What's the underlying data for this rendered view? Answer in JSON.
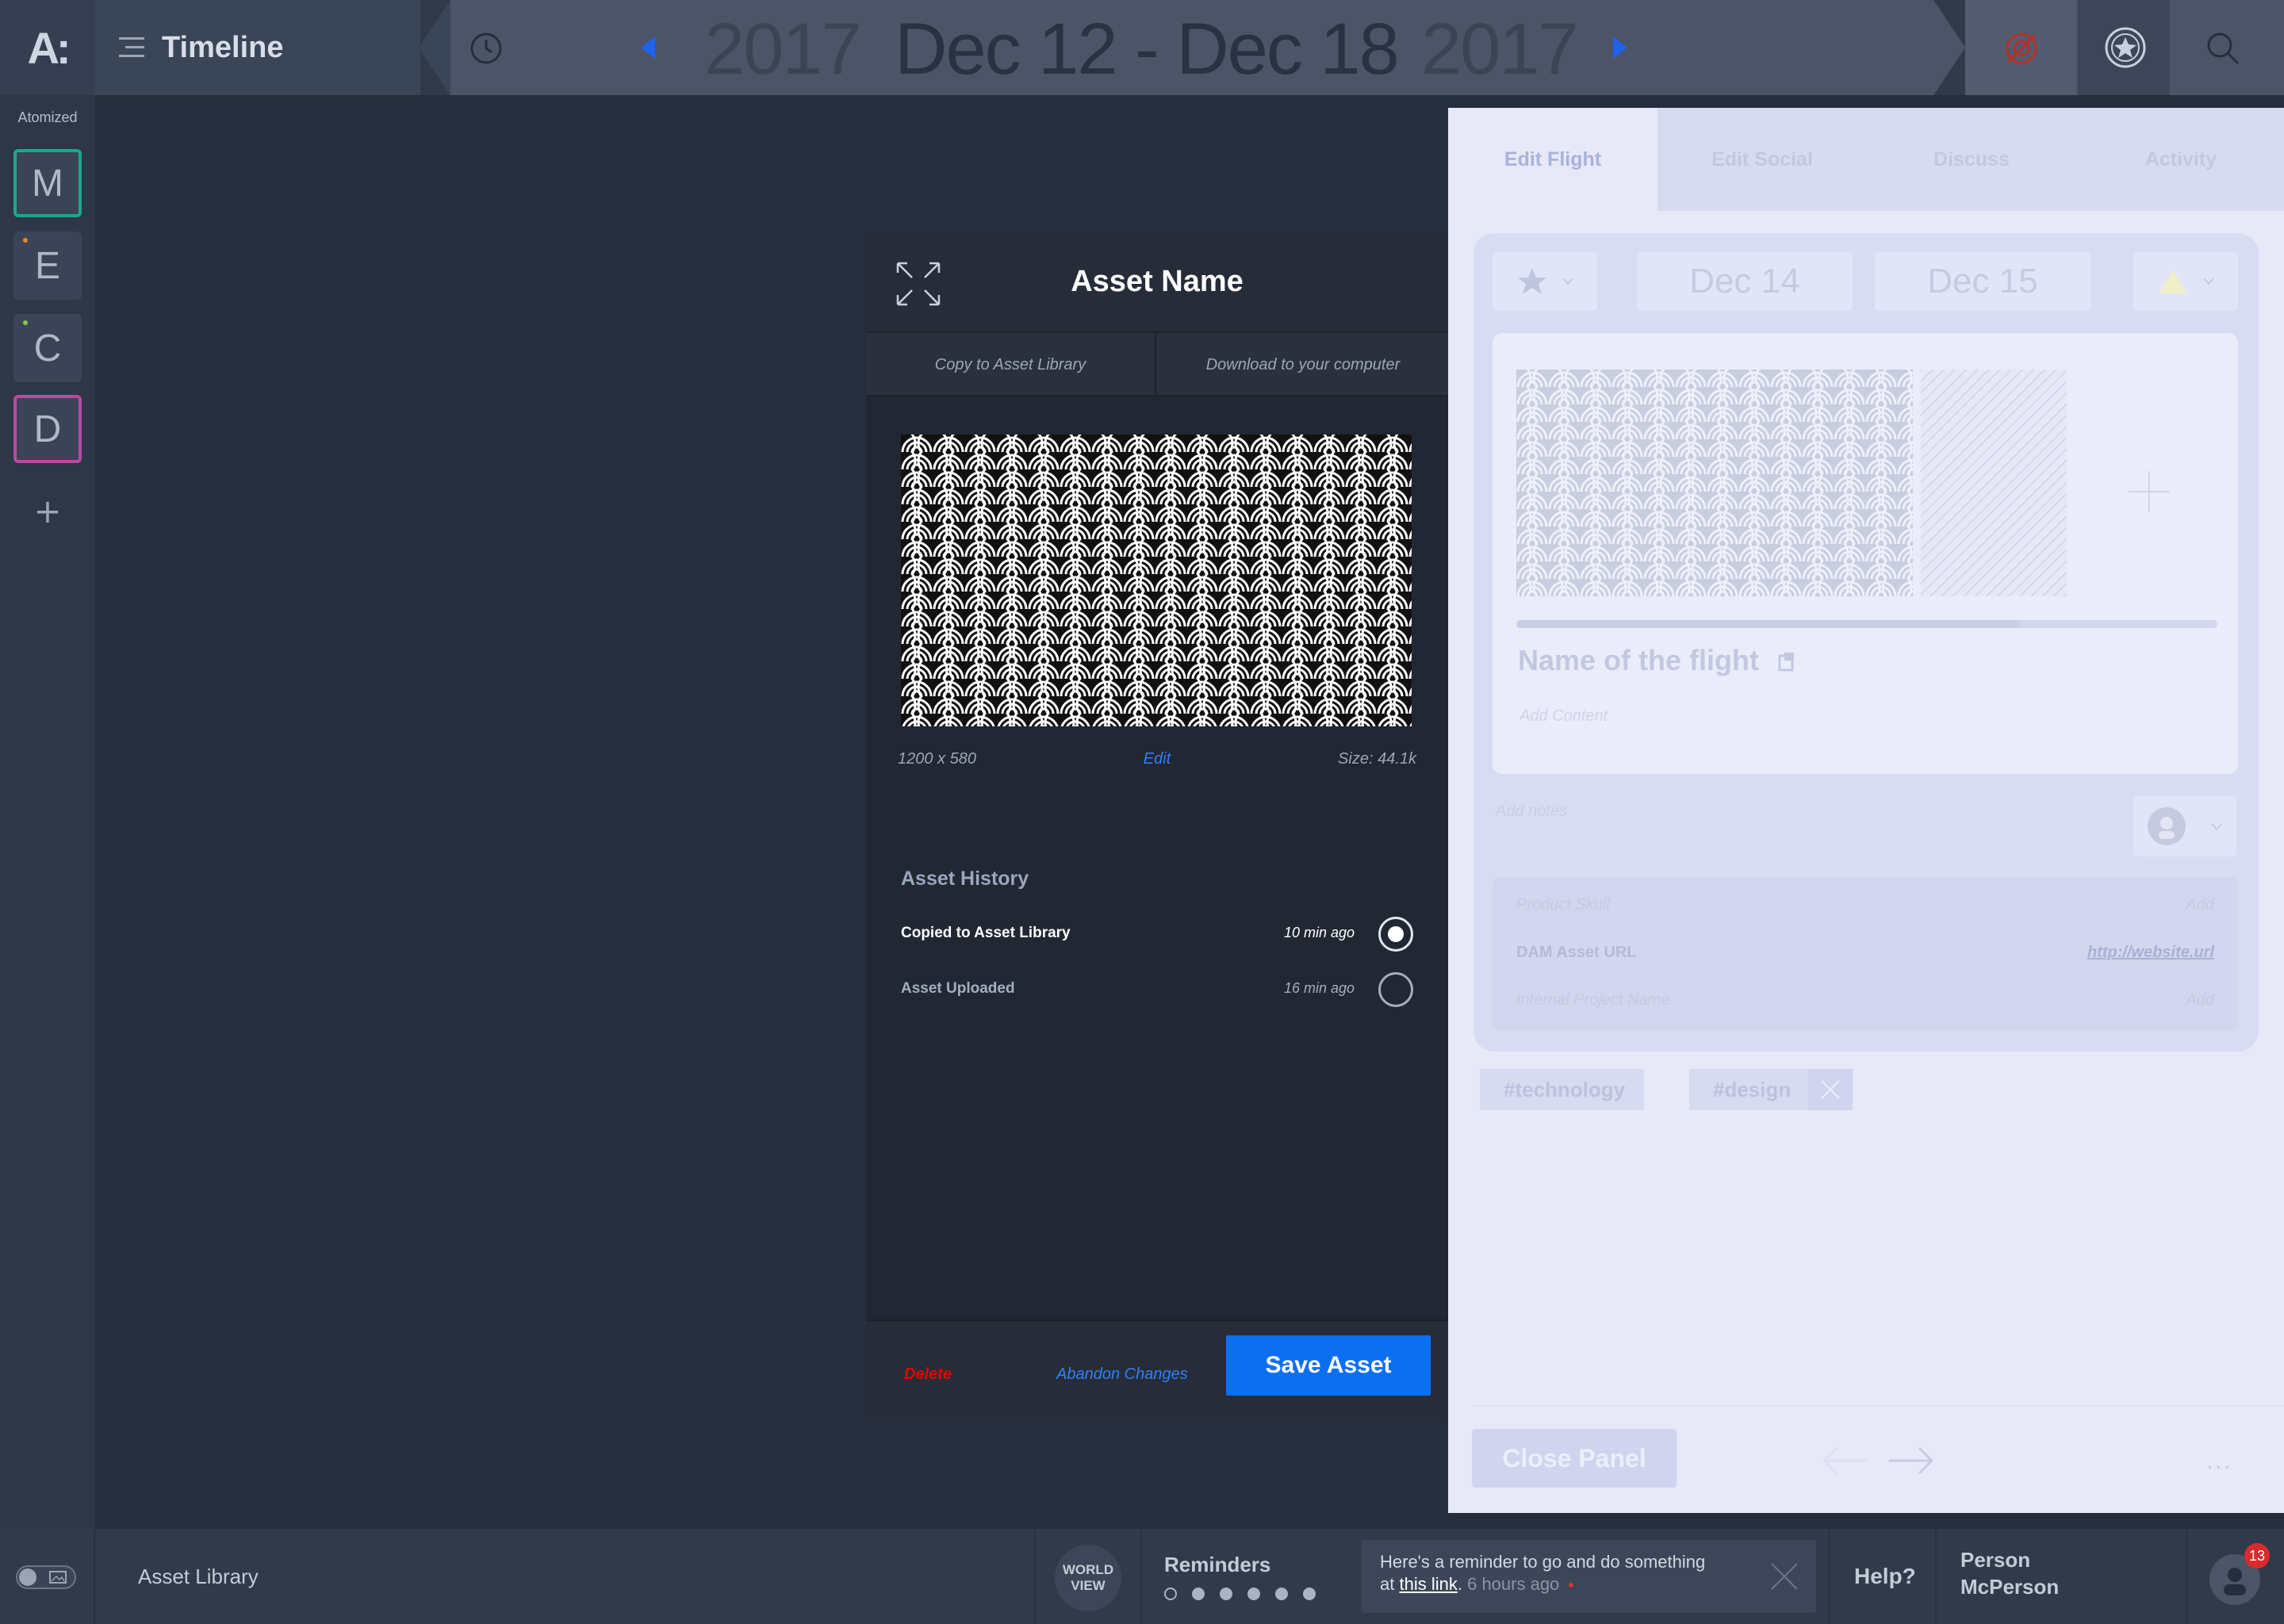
{
  "app": {
    "logo": "A:",
    "title": "Timeline"
  },
  "datenav": {
    "year_left": "2017",
    "range": "Dec 12 - Dec 18",
    "year_right": "2017"
  },
  "rail": {
    "label": "Atomized",
    "workspaces": [
      {
        "letter": "M",
        "color": "#1aa98a"
      },
      {
        "letter": "E",
        "color": "#e08a2a"
      },
      {
        "letter": "C",
        "color": "#7fc84a"
      },
      {
        "letter": "D",
        "color": "#b94aa0"
      }
    ],
    "add": "+"
  },
  "modal": {
    "title": "Asset Name",
    "copy_action": "Copy to Asset Library",
    "download_action": "Download to your computer",
    "dimensions": "1200 x 580",
    "edit": "Edit",
    "size": "Size: 44.1k",
    "history_title": "Asset History",
    "history": [
      {
        "label": "Copied to Asset Library",
        "time": "10 min ago",
        "active": true
      },
      {
        "label": "Asset Uploaded",
        "time": "16 min ago",
        "active": false
      }
    ],
    "delete": "Delete",
    "abandon": "Abandon Changes",
    "save": "Save Asset"
  },
  "panel": {
    "tabs": [
      "Edit Flight",
      "Edit Social",
      "Discuss",
      "Activity"
    ],
    "start_date": "Dec 14",
    "end_date": "Dec 15",
    "flight_name": "Name of the flight",
    "add_content": "Add Content",
    "add_notes": "Add notes",
    "meta": [
      {
        "label": "Product Skull",
        "value": "Add"
      },
      {
        "label": "DAM Asset URL",
        "value": "http://website.url"
      },
      {
        "label": "Internal Project Name",
        "value": "Add"
      }
    ],
    "tags": [
      "#technology",
      "#design"
    ],
    "close": "Close Panel",
    "more": "..."
  },
  "bottombar": {
    "asset_library": "Asset Library",
    "world_view": "WORLD VIEW",
    "reminders_title": "Reminders",
    "reminder_text_1": "Here's a reminder to go and do something",
    "reminder_text_2": "at",
    "reminder_link": "this link",
    "reminder_dot": ".",
    "reminder_time": "6 hours ago",
    "help": "Help?",
    "person_first": "Person",
    "person_last": "McPerson",
    "notification_count": "13"
  },
  "colors": {
    "accent": "#0c6ff2",
    "danger": "#e60000",
    "link": "#2f7ff7"
  }
}
